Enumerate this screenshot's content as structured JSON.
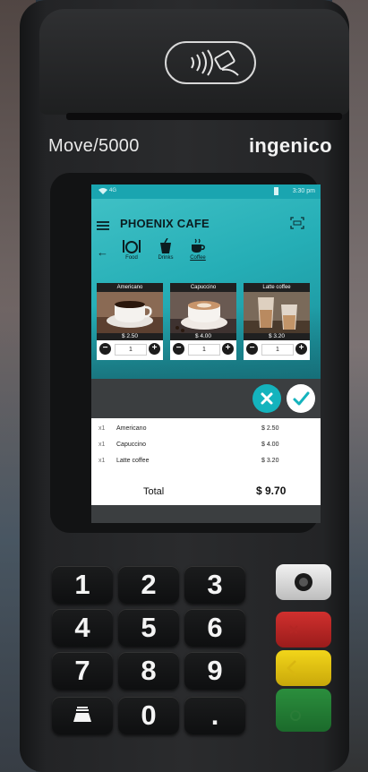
{
  "device": {
    "model": "Move/5000",
    "brand": "ingenico"
  },
  "statusbar": {
    "signal": "4G",
    "time": "3:30 pm"
  },
  "app": {
    "title": "PHOENIX CAFE",
    "categories": [
      {
        "label": "Food",
        "icon": "fork-knife-icon"
      },
      {
        "label": "Drinks",
        "icon": "drink-icon"
      },
      {
        "label": "Coffee",
        "icon": "coffee-cup-icon",
        "active": true
      }
    ],
    "products": [
      {
        "name": "Americano",
        "price": "$ 2.50",
        "qty": "1"
      },
      {
        "name": "Capuccino",
        "price": "$ 4.00",
        "qty": "1"
      },
      {
        "name": "Latte coffee",
        "price": "$ 3.20",
        "qty": "1"
      }
    ],
    "order_items": [
      {
        "qty": "x1",
        "name": "Americano",
        "price": "$ 2.50"
      },
      {
        "qty": "x1",
        "name": "Capuccino",
        "price": "$ 4.00"
      },
      {
        "qty": "x1",
        "name": "Latte coffee",
        "price": "$ 3.20"
      }
    ],
    "total_label": "Total",
    "total_value": "$ 9.70",
    "colors": {
      "accent": "#14b3bd",
      "bar": "#3b3e40"
    }
  },
  "keypad": {
    "keys": [
      "1",
      "2",
      "3",
      "4",
      "5",
      "6",
      "7",
      "8",
      "9",
      "0",
      "."
    ],
    "function_keys": [
      "camera-icon",
      "cancel-x-icon",
      "back-arrow-icon",
      "ok-circle-icon"
    ]
  }
}
